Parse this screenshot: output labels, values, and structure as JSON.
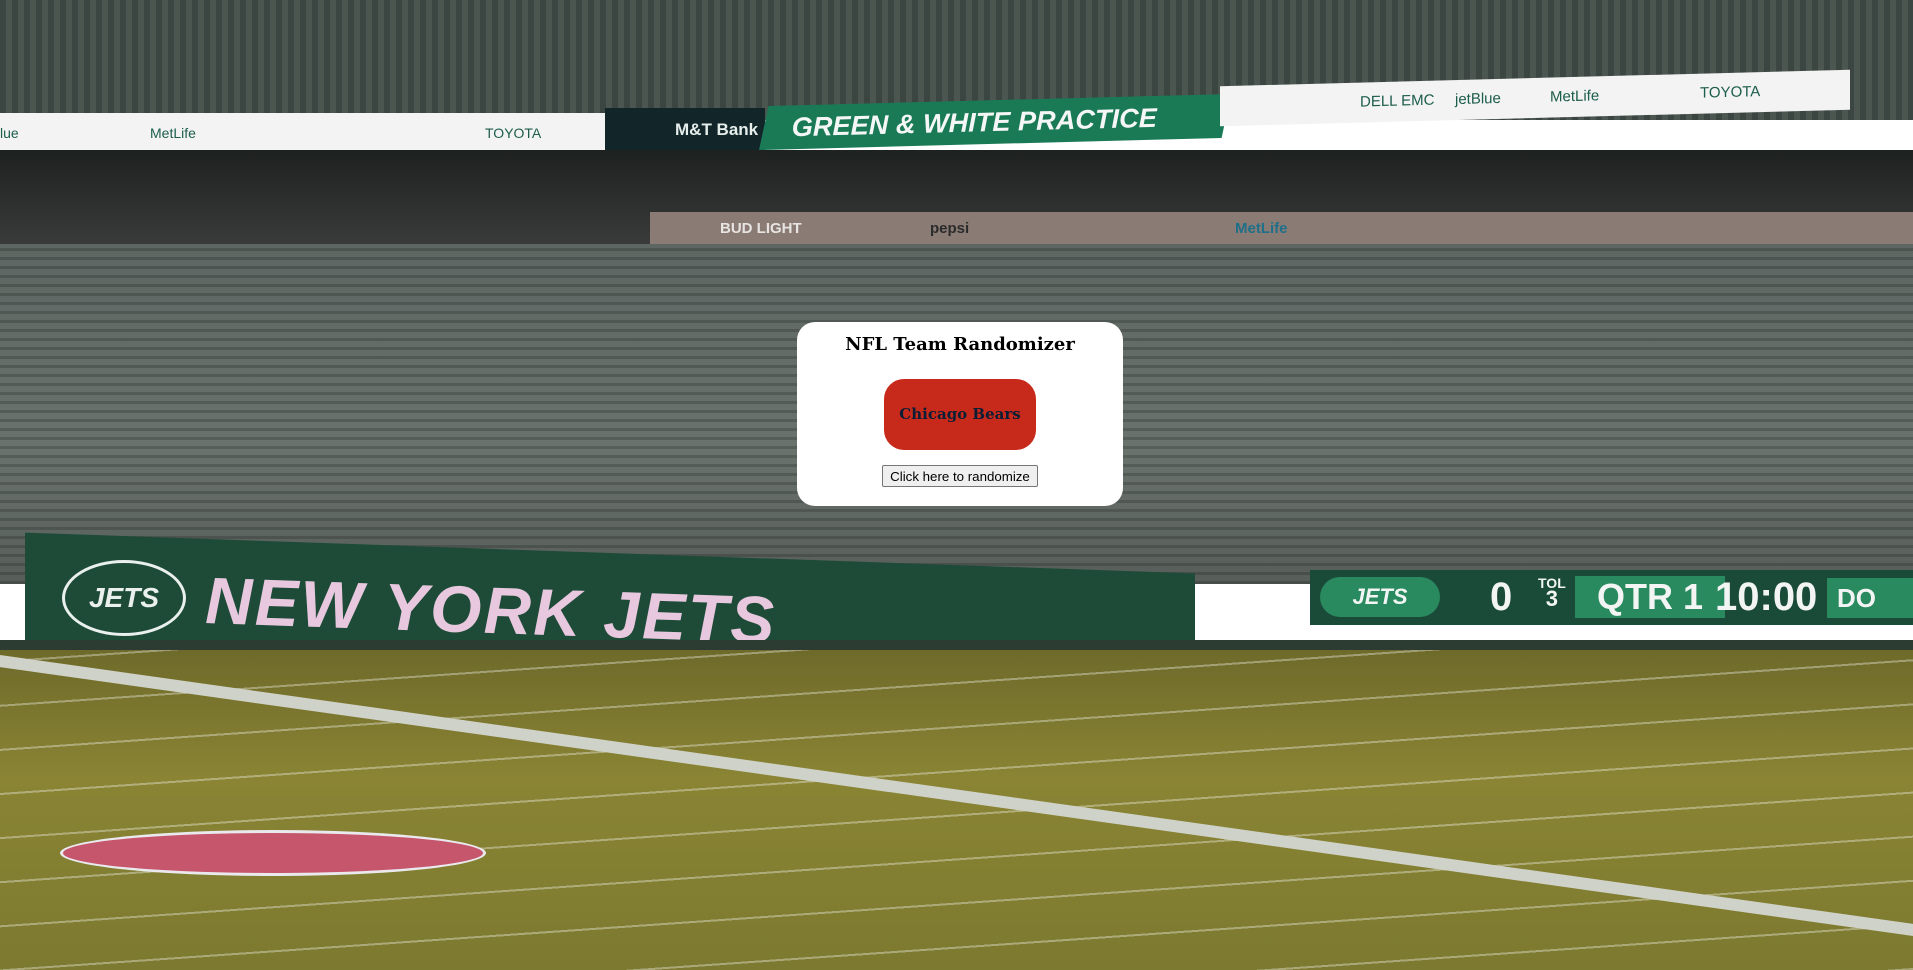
{
  "app": {
    "title": "NFL Team Randomizer",
    "current_team": "Chicago Bears",
    "randomize_button_label": "Click here to randomize"
  },
  "colors": {
    "team_pill_background": "#c72a1a",
    "team_pill_text": "#0b1d35",
    "card_background": "#ffffff"
  },
  "background": {
    "ribbon_left": [
      "lue",
      "MetLife",
      "TOYOTA"
    ],
    "ribbon_right": [
      "DELL EMC",
      "jetBlue",
      "MetLife",
      "TOYOTA"
    ],
    "banner_dark_text": "M&T Bank",
    "banner_green_text": "GREEN & WHITE PRACTICE",
    "facade_ads": [
      "BUD LIGHT",
      "pepsi",
      "MetLife"
    ],
    "wall_logo_text": "JETS",
    "wall_text": "NEW YORK JETS",
    "scoreboard": {
      "logo": "JETS",
      "score": "0",
      "tol_label": "TOL",
      "tol_value": "3",
      "quarter": "QTR 1",
      "clock": "10:00",
      "tail": "DO"
    }
  }
}
